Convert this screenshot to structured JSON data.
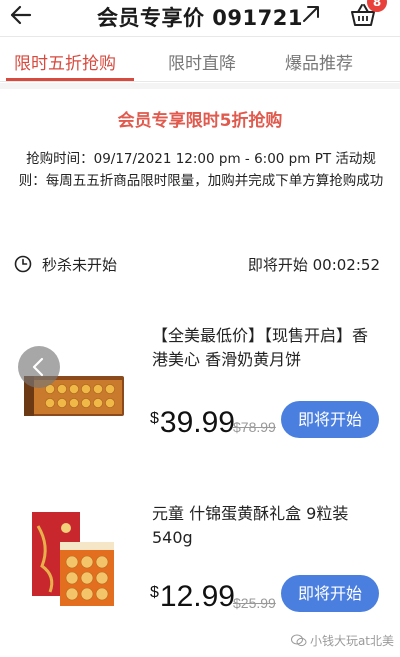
{
  "header": {
    "title": "会员专享价 091721",
    "cart_badge": "8",
    "icons": {
      "back": "back-arrow-icon",
      "share": "share-arrow-icon",
      "cart": "basket-icon"
    }
  },
  "tabs": [
    {
      "label": "限时五折抢购",
      "active": true
    },
    {
      "label": "限时直降",
      "active": false
    },
    {
      "label": "爆品推荐",
      "active": false
    }
  ],
  "promo": {
    "title": "会员专享限时5折抢购",
    "description": "抢购时间：09/17/2021 12:00 pm - 6:00 pm PT 活动规则：每周五五折商品限时限量，加购并完成下单方算抢购成功"
  },
  "status": {
    "left": "秒杀未开始",
    "right": "即将开始 00:02:52"
  },
  "products": [
    {
      "name": "【全美最低价】【现售开启】香港美心 香滑奶黄月饼",
      "currency": "$",
      "price": "39.99",
      "original_price": "$78.99",
      "button": "即将开始"
    },
    {
      "name": "元童 什锦蛋黄酥礼盒 9粒装 540g",
      "currency": "$",
      "price": "12.99",
      "original_price": "$25.99",
      "button": "即将开始"
    }
  ],
  "watermark": "小钱大玩at北美",
  "colors": {
    "accent": "#d84a3e",
    "button": "#4a7fe0",
    "badge": "#e8403a"
  }
}
